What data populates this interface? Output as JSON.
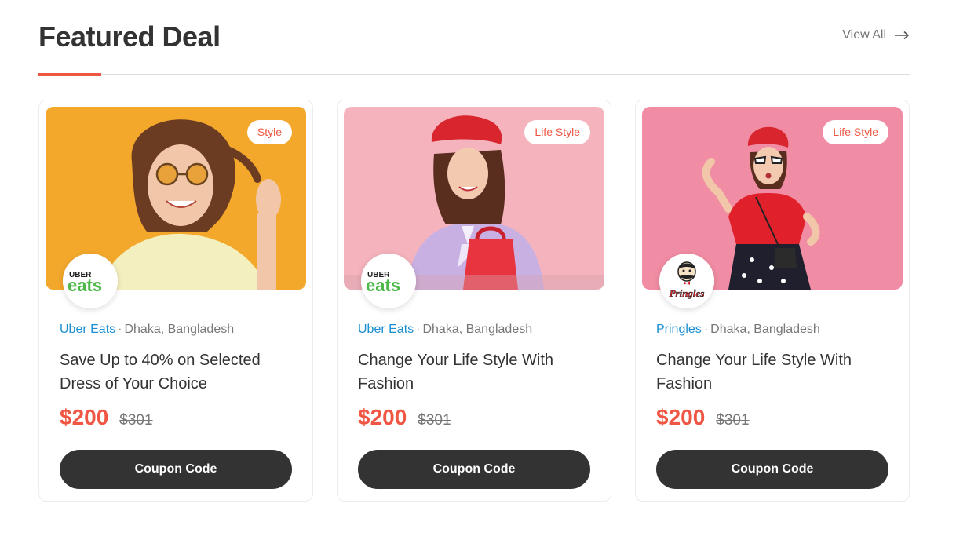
{
  "section": {
    "title": "Featured Deal",
    "view_all_label": "View All",
    "accent_color": "#ef5744"
  },
  "cards": [
    {
      "badge": "Style",
      "brand": "Uber Eats",
      "logo_icon": "uber-eats-logo",
      "location": "Dhaka, Bangladesh",
      "title": "Save Up to 40% on Selected Dress of Your Choice",
      "price": "$200",
      "old_price": "$301",
      "button_label": "Coupon Code",
      "image_bg": "#f1a225"
    },
    {
      "badge": "Life Style",
      "brand": "Uber Eats",
      "logo_icon": "uber-eats-logo",
      "location": "Dhaka, Bangladesh",
      "title": "Change Your Life Style With Fashion",
      "price": "$200",
      "old_price": "$301",
      "button_label": "Coupon Code",
      "image_bg": "#f4b3bd"
    },
    {
      "badge": "Life Style",
      "brand": "Pringles",
      "logo_icon": "pringles-logo",
      "location": "Dhaka, Bangladesh",
      "title": "Change Your Life Style With Fashion",
      "price": "$200",
      "old_price": "$301",
      "button_label": "Coupon Code",
      "image_bg": "#f08ca3"
    }
  ],
  "logos": {
    "uber_top": "UBER",
    "uber_bottom": "eats",
    "pringles": "Pringles"
  }
}
